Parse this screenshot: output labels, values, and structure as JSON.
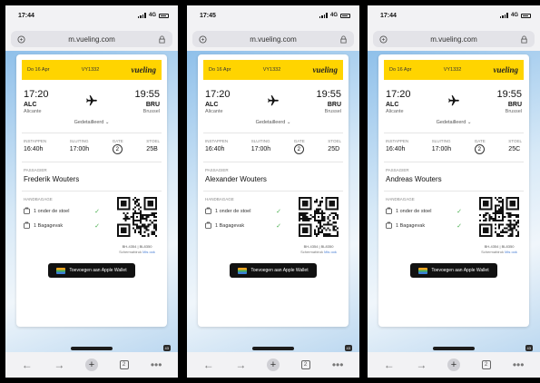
{
  "colors": {
    "brand_yellow": "#ffd400",
    "check_green": "#4caf50",
    "wallet_black": "#111111"
  },
  "screens": [
    {
      "status_time": "17:44",
      "network": "4G",
      "url": "m.vueling.com",
      "date": "Do 16 Apr",
      "flight": "VY1332",
      "brand": "vueling",
      "dep_time": "17:20",
      "dep_code": "ALC",
      "dep_city": "Alicante",
      "arr_time": "19:55",
      "arr_code": "BRU",
      "arr_city": "Brussel",
      "details_label": "Gedetailleerd",
      "boarding_label": "Instappen",
      "boarding_value": "16:40h",
      "closing_label": "Sluiting",
      "closing_value": "17:00h",
      "gate_label": "Gate",
      "gate_value": "2",
      "seat_label": "Stoel",
      "seat_value": "25B",
      "passenger_label": "Passagier",
      "passenger_name": "Frederik Wouters",
      "baggage_label": "Handbagage",
      "bag_items": [
        "1 onder de stoel",
        "1 Bagagevak"
      ],
      "qr_caption": "BH-4354 | BL8350",
      "qr_sub": "Schermafdruk",
      "qr_sub_link": "Mis ook",
      "wallet_label": "Toevoegen aan Apple Wallet",
      "tab_count": "43"
    },
    {
      "status_time": "17:45",
      "network": "4G",
      "url": "m.vueling.com",
      "date": "Do 16 Apr",
      "flight": "VY1332",
      "brand": "vueling",
      "dep_time": "17:20",
      "dep_code": "ALC",
      "dep_city": "Alicante",
      "arr_time": "19:55",
      "arr_code": "BRU",
      "arr_city": "Brussel",
      "details_label": "Gedetailleerd",
      "boarding_label": "Instappen",
      "boarding_value": "16:40h",
      "closing_label": "Sluiting",
      "closing_value": "17:00h",
      "gate_label": "Gate",
      "gate_value": "2",
      "seat_label": "Stoel",
      "seat_value": "25D",
      "passenger_label": "Passagier",
      "passenger_name": "Alexander Wouters",
      "baggage_label": "Handbagage",
      "bag_items": [
        "1 onder de stoel",
        "1 Bagagevak"
      ],
      "qr_caption": "BH-4354 | BL8350",
      "qr_sub": "Schermafdruk",
      "qr_sub_link": "Mis ook",
      "wallet_label": "Toevoegen aan Apple Wallet",
      "tab_count": "43"
    },
    {
      "status_time": "17:44",
      "network": "4G",
      "url": "m.vueling.com",
      "date": "Do 16 Apr",
      "flight": "VY1332",
      "brand": "vueling",
      "dep_time": "17:20",
      "dep_code": "ALC",
      "dep_city": "Alicante",
      "arr_time": "19:55",
      "arr_code": "BRU",
      "arr_city": "Brussel",
      "details_label": "Gedetailleerd",
      "boarding_label": "Instappen",
      "boarding_value": "16:40h",
      "closing_label": "Sluiting",
      "closing_value": "17:00h",
      "gate_label": "Gate",
      "gate_value": "2",
      "seat_label": "Stoel",
      "seat_value": "25C",
      "passenger_label": "Passagier",
      "passenger_name": "Andreas Wouters",
      "baggage_label": "Handbagage",
      "bag_items": [
        "1 onder de stoel",
        "1 Bagagevak"
      ],
      "qr_caption": "BH-4354 | BL8350",
      "qr_sub": "Schermafdruk",
      "qr_sub_link": "Mis ook",
      "wallet_label": "Toevoegen aan Apple Wallet",
      "tab_count": "43"
    }
  ]
}
